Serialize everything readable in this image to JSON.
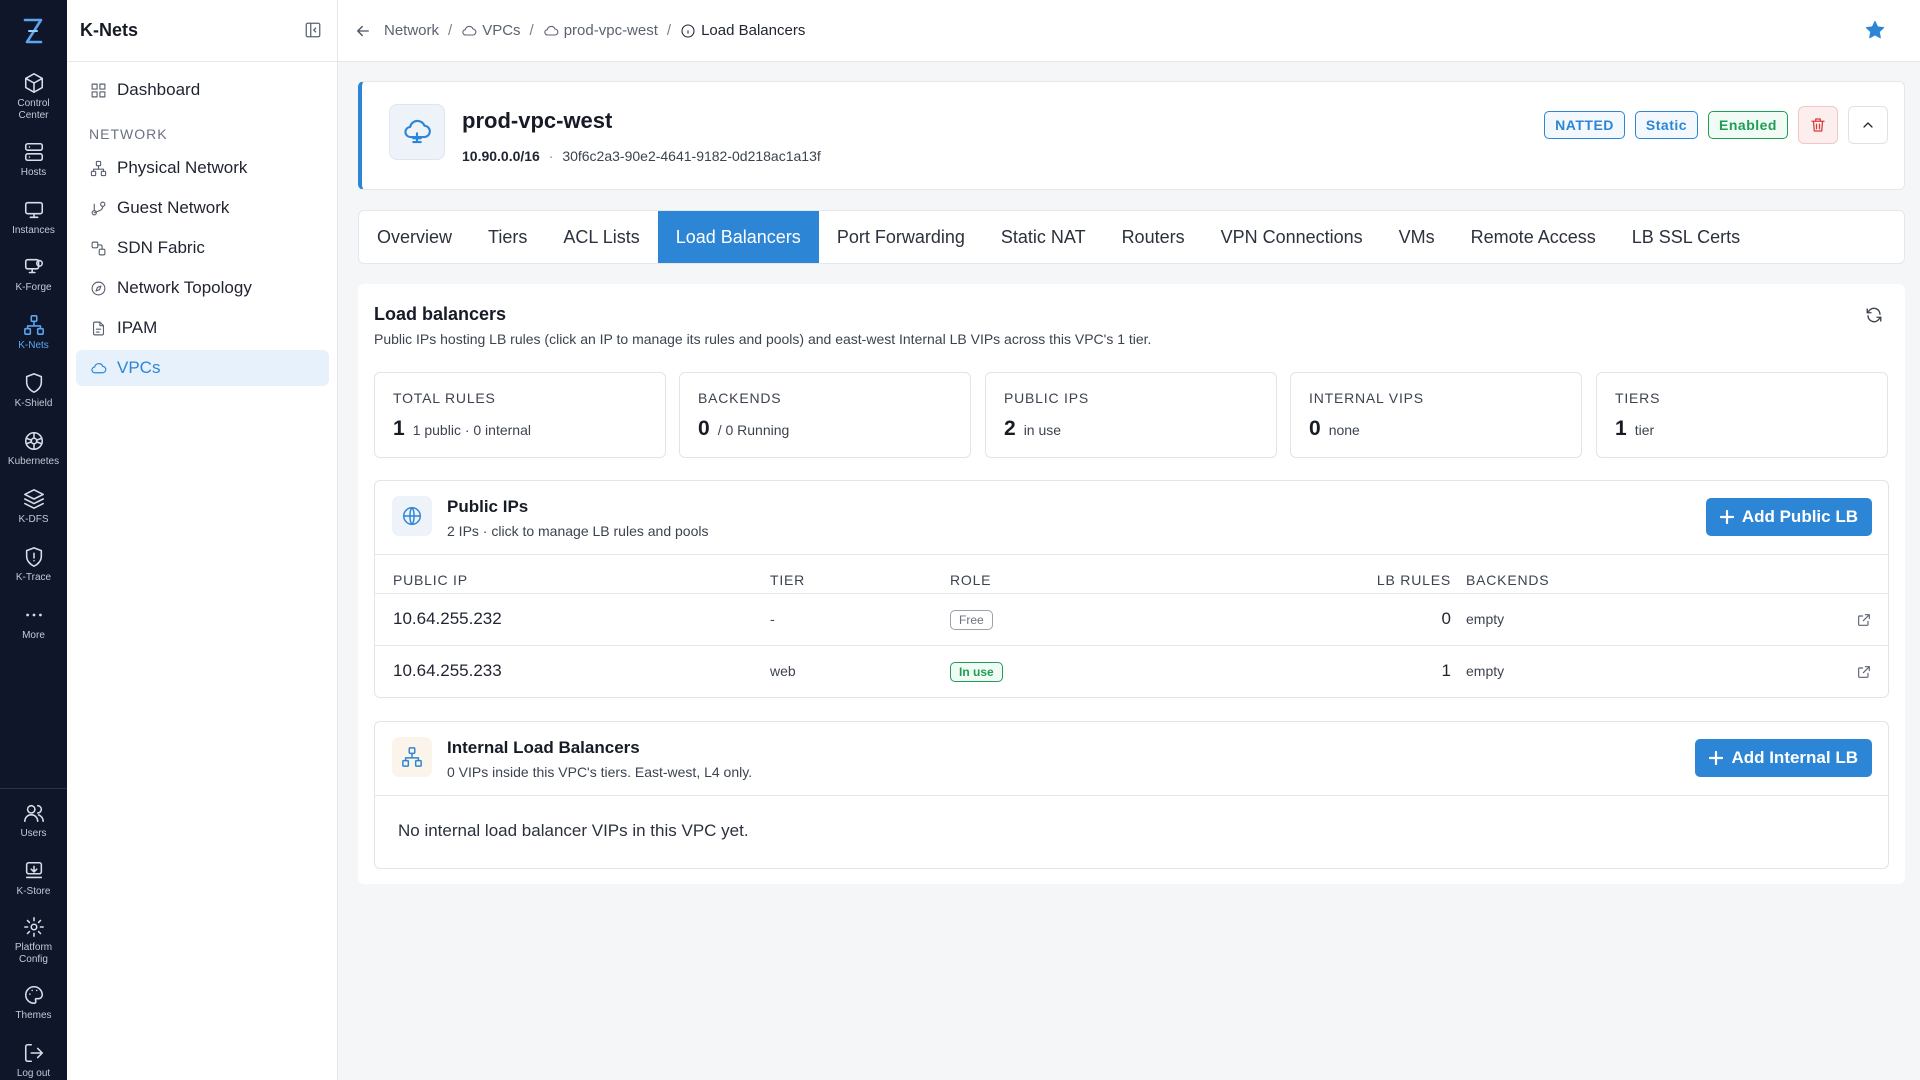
{
  "rail": {
    "items": [
      {
        "label": "Control Center",
        "icon": "cube-icon"
      },
      {
        "label": "Hosts",
        "icon": "server-icon"
      },
      {
        "label": "Instances",
        "icon": "monitor-icon"
      },
      {
        "label": "K-Forge",
        "icon": "forge-icon"
      },
      {
        "label": "K-Nets",
        "icon": "network-icon",
        "active": true
      },
      {
        "label": "K-Shield",
        "icon": "shield-icon"
      },
      {
        "label": "Kubernetes",
        "icon": "kubernetes-icon"
      },
      {
        "label": "K-DFS",
        "icon": "layers-icon"
      },
      {
        "label": "K-Trace",
        "icon": "trace-shield-icon"
      },
      {
        "label": "More",
        "icon": "more-dots-icon"
      }
    ],
    "bottom": [
      {
        "label": "Users",
        "icon": "users-icon"
      },
      {
        "label": "K-Store",
        "icon": "store-icon"
      },
      {
        "label": "Platform Config",
        "icon": "gear-icon"
      },
      {
        "label": "Themes",
        "icon": "palette-icon"
      },
      {
        "label": "Log out",
        "icon": "logout-icon"
      }
    ]
  },
  "sidebar": {
    "title": "K-Nets",
    "dashboard": "Dashboard",
    "section": "NETWORK",
    "items": [
      "Physical Network",
      "Guest Network",
      "SDN Fabric",
      "Network Topology",
      "IPAM",
      "VPCs"
    ]
  },
  "breadcrumb": [
    "Network",
    "VPCs",
    "prod-vpc-west",
    "Load Balancers"
  ],
  "vpc": {
    "name": "prod-vpc-west",
    "cidr": "10.90.0.0/16",
    "sep": "·",
    "id": "30f6c2a3-90e2-4641-9182-0d218ac1a13f",
    "badges": [
      "NATTED",
      "Static",
      "Enabled"
    ]
  },
  "tabs": [
    "Overview",
    "Tiers",
    "ACL Lists",
    "Load Balancers",
    "Port Forwarding",
    "Static NAT",
    "Routers",
    "VPN Connections",
    "VMs",
    "Remote Access",
    "LB SSL Certs"
  ],
  "lb": {
    "title": "Load balancers",
    "subtitle": "Public IPs hosting LB rules (click an IP to manage its rules and pools) and east-west Internal LB VIPs across this VPC's 1 tier.",
    "stats": [
      {
        "label": "TOTAL RULES",
        "value": "1",
        "desc": "1 public · 0 internal"
      },
      {
        "label": "BACKENDS",
        "value": "0",
        "desc": "/ 0 Running"
      },
      {
        "label": "PUBLIC IPS",
        "value": "2",
        "desc": "in use"
      },
      {
        "label": "INTERNAL VIPS",
        "value": "0",
        "desc": "none"
      },
      {
        "label": "TIERS",
        "value": "1",
        "desc": "tier"
      }
    ],
    "public": {
      "title": "Public IPs",
      "desc": "2 IPs · click to manage LB rules and pools",
      "button": "Add Public LB",
      "columns": [
        "PUBLIC IP",
        "TIER",
        "ROLE",
        "LB RULES",
        "BACKENDS"
      ],
      "rows": [
        {
          "ip": "10.64.255.232",
          "tier": "-",
          "role": "Free",
          "rules": "0",
          "backends": "empty"
        },
        {
          "ip": "10.64.255.233",
          "tier": "web",
          "role": "In use",
          "rules": "1",
          "backends": "empty"
        }
      ]
    },
    "internal": {
      "title": "Internal Load Balancers",
      "desc": "0 VIPs inside this VPC's tiers. East-west, L4 only.",
      "button": "Add Internal LB",
      "empty": "No internal load balancer VIPs in this VPC yet."
    }
  },
  "colors": {
    "accent": "#2d85d6",
    "rail": "#0f1629",
    "success": "#1f9d55",
    "danger": "#d83b3b"
  }
}
